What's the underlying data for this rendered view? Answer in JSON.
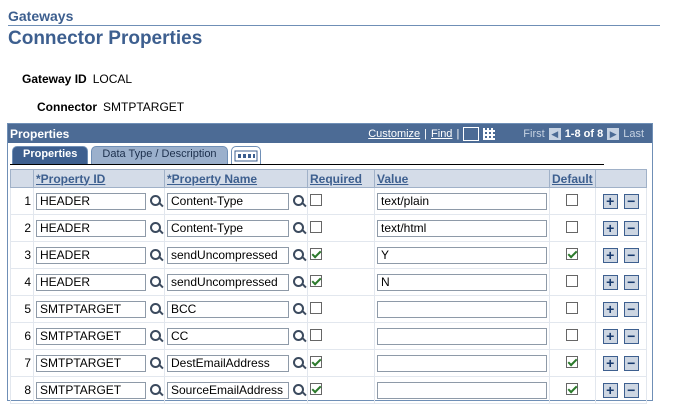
{
  "header": {
    "breadcrumb": "Gateways",
    "title": "Connector Properties"
  },
  "fields": {
    "gateway_label": "Gateway ID",
    "gateway_value": "LOCAL",
    "connector_label": "Connector",
    "connector_value": "SMTPTARGET"
  },
  "grid": {
    "title": "Properties",
    "customize": "Customize",
    "find": "Find",
    "first": "First",
    "range": "1-8 of 8",
    "last": "Last",
    "tabs": [
      "Properties",
      "Data Type / Description"
    ],
    "columns": [
      "*Property ID",
      "*Property Name",
      "Required",
      "Value",
      "Default"
    ],
    "rows": [
      {
        "num": "1",
        "id": "HEADER",
        "name": "Content-Type",
        "required": false,
        "value": "text/plain",
        "default": false
      },
      {
        "num": "2",
        "id": "HEADER",
        "name": "Content-Type",
        "required": false,
        "value": "text/html",
        "default": false
      },
      {
        "num": "3",
        "id": "HEADER",
        "name": "sendUncompressed",
        "required": true,
        "value": "Y",
        "default": true
      },
      {
        "num": "4",
        "id": "HEADER",
        "name": "sendUncompressed",
        "required": true,
        "value": "N",
        "default": false
      },
      {
        "num": "5",
        "id": "SMTPTARGET",
        "name": "BCC",
        "required": false,
        "value": "",
        "default": false
      },
      {
        "num": "6",
        "id": "SMTPTARGET",
        "name": "CC",
        "required": false,
        "value": "",
        "default": false
      },
      {
        "num": "7",
        "id": "SMTPTARGET",
        "name": "DestEmailAddress",
        "required": true,
        "value": "",
        "default": true
      },
      {
        "num": "8",
        "id": "SMTPTARGET",
        "name": "SourceEmailAddress",
        "required": true,
        "value": "",
        "default": true
      }
    ]
  },
  "icons": {
    "lookup": "magnifier-icon",
    "add": "+",
    "delete": "−",
    "prev": "◀",
    "next": "▶"
  }
}
